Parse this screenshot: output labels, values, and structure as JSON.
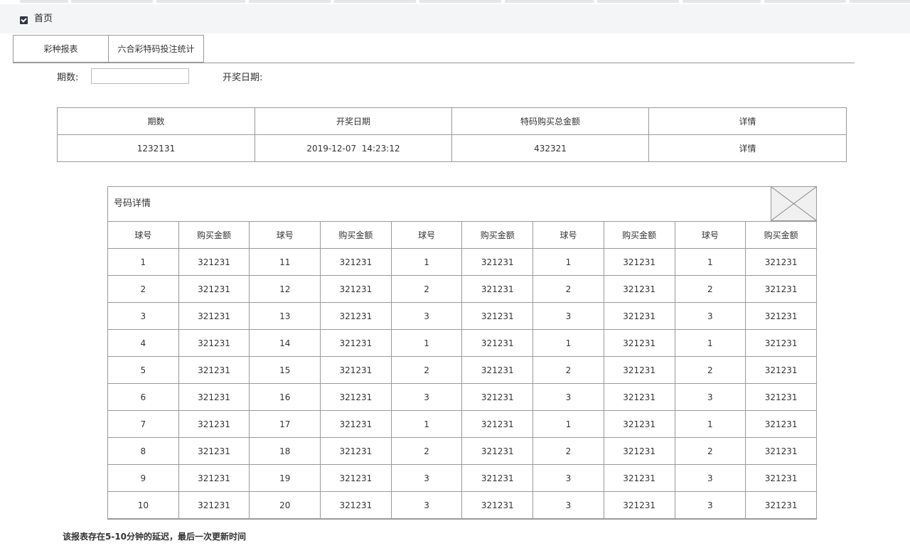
{
  "header": {
    "title": "首页",
    "icon": "checkbox-icon"
  },
  "tabs": [
    {
      "label": "彩种报表"
    },
    {
      "label": "六合彩特码投注统计"
    }
  ],
  "filters": {
    "period_label": "期数:",
    "period_value": "",
    "draw_date_label": "开奖日期:"
  },
  "summary": {
    "headers": [
      "期数",
      "开奖日期",
      "特码购买总金额",
      "详情"
    ],
    "row": [
      "1232131",
      "2019-12-07  14:23:12",
      "432321",
      "详情"
    ]
  },
  "detail": {
    "title": "号码详情",
    "headers": [
      "球号",
      "购买金额",
      "球号",
      "购买金额",
      "球号",
      "购买金额",
      "球号",
      "购买金额",
      "球号",
      "购买金额"
    ],
    "rows": [
      [
        "1",
        "321231",
        "11",
        "321231",
        "1",
        "321231",
        "1",
        "321231",
        "1",
        "321231"
      ],
      [
        "2",
        "321231",
        "12",
        "321231",
        "2",
        "321231",
        "2",
        "321231",
        "2",
        "321231"
      ],
      [
        "3",
        "321231",
        "13",
        "321231",
        "3",
        "321231",
        "3",
        "321231",
        "3",
        "321231"
      ],
      [
        "4",
        "321231",
        "14",
        "321231",
        "1",
        "321231",
        "1",
        "321231",
        "1",
        "321231"
      ],
      [
        "5",
        "321231",
        "15",
        "321231",
        "2",
        "321231",
        "2",
        "321231",
        "2",
        "321231"
      ],
      [
        "6",
        "321231",
        "16",
        "321231",
        "3",
        "321231",
        "3",
        "321231",
        "3",
        "321231"
      ],
      [
        "7",
        "321231",
        "17",
        "321231",
        "1",
        "321231",
        "1",
        "321231",
        "1",
        "321231"
      ],
      [
        "8",
        "321231",
        "18",
        "321231",
        "2",
        "321231",
        "2",
        "321231",
        "2",
        "321231"
      ],
      [
        "9",
        "321231",
        "19",
        "321231",
        "3",
        "321231",
        "3",
        "321231",
        "3",
        "321231"
      ],
      [
        "10",
        "321231",
        "20",
        "321231",
        "3",
        "321231",
        "3",
        "321231",
        "3",
        "321231"
      ]
    ]
  },
  "footnote": "该报表存在5-10分钟的延迟，最后一次更新时间"
}
